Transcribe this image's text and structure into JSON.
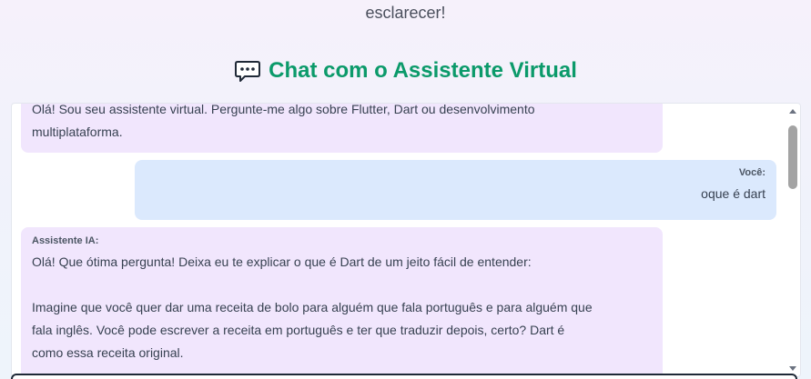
{
  "intro": {
    "trailing_text": "esclarecer!"
  },
  "chat": {
    "title": "Chat com o Assistente Virtual",
    "title_icon": "chat-bubble-dots-icon",
    "accent_color": "#0b9a6a",
    "messages": [
      {
        "role": "assistant",
        "author": "",
        "text": "Olá! Sou seu assistente virtual. Pergunte-me algo sobre Flutter, Dart ou desenvolvimento\nmultiplataforma."
      },
      {
        "role": "user",
        "author": "Você:",
        "text": "oque é dart"
      },
      {
        "role": "assistant",
        "author": "Assistente IA:",
        "text": "Olá! Que ótima pergunta! Deixa eu te explicar o que é Dart de um jeito fácil de entender:\n\nImagine que você quer dar uma receita de bolo para alguém que fala português e para alguém que\nfala inglês. Você pode escrever a receita em português e ter que traduzir depois, certo? Dart é\ncomo essa receita original."
      }
    ],
    "colors": {
      "assistant_bubble": "#f1e6fd",
      "user_bubble": "#dbe9fd"
    }
  }
}
